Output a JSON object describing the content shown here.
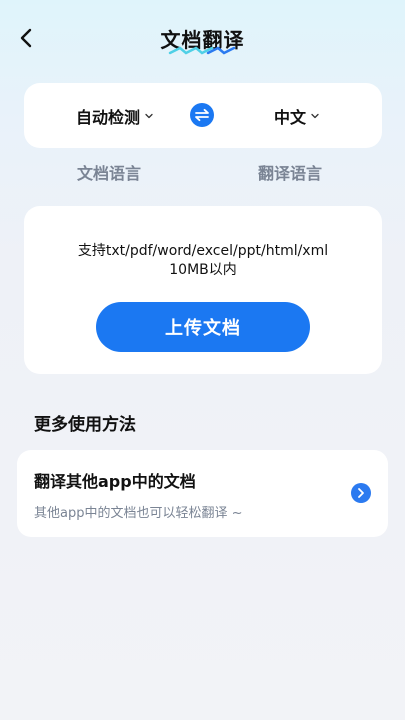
{
  "header": {
    "title": "文档翻译",
    "back_icon": "chevron-left-icon"
  },
  "languages": {
    "source": "自动检测",
    "target": "中文",
    "source_caption": "文档语言",
    "target_caption": "翻译语言",
    "swap_icon": "swap-arrows-icon"
  },
  "upload": {
    "formats_line1": "支持txt/pdf/word/excel/ppt/html/xml",
    "formats_line2": "10MB以内",
    "button_label": "上传文档"
  },
  "more": {
    "section_title": "更多使用方法",
    "items": [
      {
        "title": "翻译其他app中的文档",
        "description": "其他app中的文档也可以轻松翻译 ~",
        "icon": "chevron-right-icon"
      }
    ]
  },
  "colors": {
    "accent": "#1b78f2",
    "muted_text": "#7a8494",
    "background": "#f2f3f7",
    "card": "#ffffff"
  }
}
